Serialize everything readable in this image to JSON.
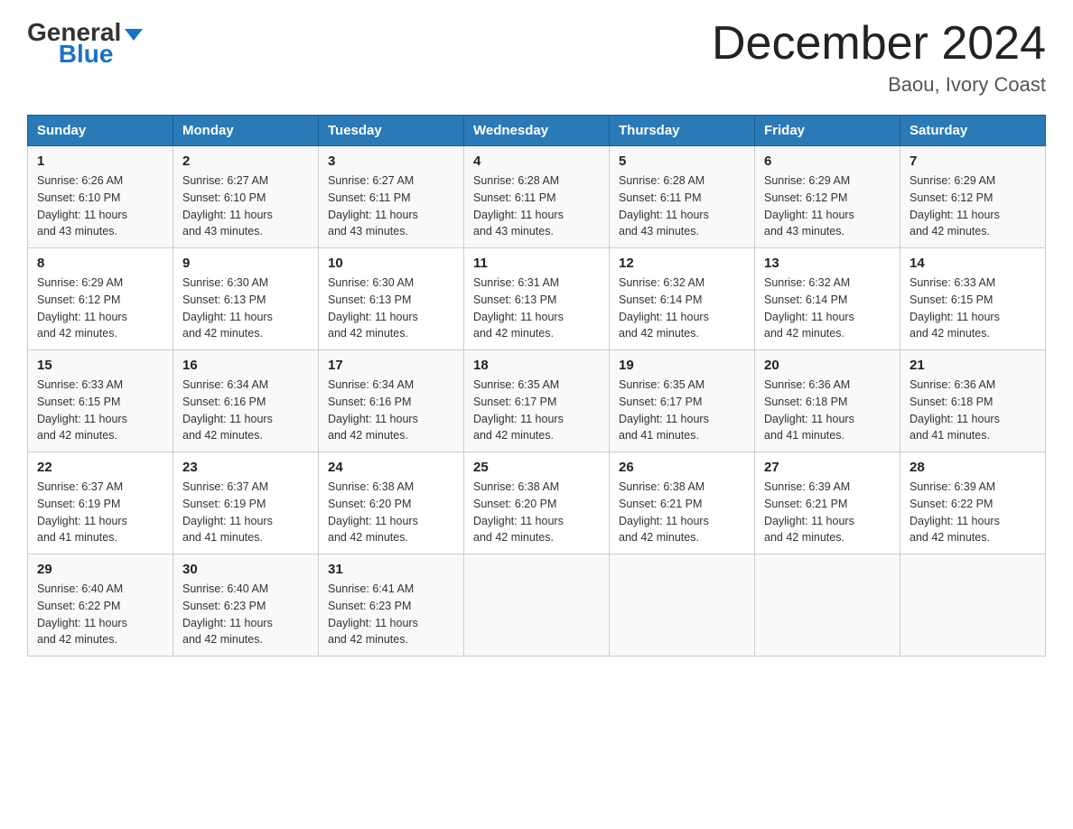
{
  "header": {
    "logo_general": "General",
    "logo_blue": "Blue",
    "month_title": "December 2024",
    "subtitle": "Baou, Ivory Coast"
  },
  "days_of_week": [
    "Sunday",
    "Monday",
    "Tuesday",
    "Wednesday",
    "Thursday",
    "Friday",
    "Saturday"
  ],
  "weeks": [
    [
      {
        "day": "1",
        "sunrise": "6:26 AM",
        "sunset": "6:10 PM",
        "daylight": "11 hours and 43 minutes."
      },
      {
        "day": "2",
        "sunrise": "6:27 AM",
        "sunset": "6:10 PM",
        "daylight": "11 hours and 43 minutes."
      },
      {
        "day": "3",
        "sunrise": "6:27 AM",
        "sunset": "6:11 PM",
        "daylight": "11 hours and 43 minutes."
      },
      {
        "day": "4",
        "sunrise": "6:28 AM",
        "sunset": "6:11 PM",
        "daylight": "11 hours and 43 minutes."
      },
      {
        "day": "5",
        "sunrise": "6:28 AM",
        "sunset": "6:11 PM",
        "daylight": "11 hours and 43 minutes."
      },
      {
        "day": "6",
        "sunrise": "6:29 AM",
        "sunset": "6:12 PM",
        "daylight": "11 hours and 43 minutes."
      },
      {
        "day": "7",
        "sunrise": "6:29 AM",
        "sunset": "6:12 PM",
        "daylight": "11 hours and 42 minutes."
      }
    ],
    [
      {
        "day": "8",
        "sunrise": "6:29 AM",
        "sunset": "6:12 PM",
        "daylight": "11 hours and 42 minutes."
      },
      {
        "day": "9",
        "sunrise": "6:30 AM",
        "sunset": "6:13 PM",
        "daylight": "11 hours and 42 minutes."
      },
      {
        "day": "10",
        "sunrise": "6:30 AM",
        "sunset": "6:13 PM",
        "daylight": "11 hours and 42 minutes."
      },
      {
        "day": "11",
        "sunrise": "6:31 AM",
        "sunset": "6:13 PM",
        "daylight": "11 hours and 42 minutes."
      },
      {
        "day": "12",
        "sunrise": "6:32 AM",
        "sunset": "6:14 PM",
        "daylight": "11 hours and 42 minutes."
      },
      {
        "day": "13",
        "sunrise": "6:32 AM",
        "sunset": "6:14 PM",
        "daylight": "11 hours and 42 minutes."
      },
      {
        "day": "14",
        "sunrise": "6:33 AM",
        "sunset": "6:15 PM",
        "daylight": "11 hours and 42 minutes."
      }
    ],
    [
      {
        "day": "15",
        "sunrise": "6:33 AM",
        "sunset": "6:15 PM",
        "daylight": "11 hours and 42 minutes."
      },
      {
        "day": "16",
        "sunrise": "6:34 AM",
        "sunset": "6:16 PM",
        "daylight": "11 hours and 42 minutes."
      },
      {
        "day": "17",
        "sunrise": "6:34 AM",
        "sunset": "6:16 PM",
        "daylight": "11 hours and 42 minutes."
      },
      {
        "day": "18",
        "sunrise": "6:35 AM",
        "sunset": "6:17 PM",
        "daylight": "11 hours and 42 minutes."
      },
      {
        "day": "19",
        "sunrise": "6:35 AM",
        "sunset": "6:17 PM",
        "daylight": "11 hours and 41 minutes."
      },
      {
        "day": "20",
        "sunrise": "6:36 AM",
        "sunset": "6:18 PM",
        "daylight": "11 hours and 41 minutes."
      },
      {
        "day": "21",
        "sunrise": "6:36 AM",
        "sunset": "6:18 PM",
        "daylight": "11 hours and 41 minutes."
      }
    ],
    [
      {
        "day": "22",
        "sunrise": "6:37 AM",
        "sunset": "6:19 PM",
        "daylight": "11 hours and 41 minutes."
      },
      {
        "day": "23",
        "sunrise": "6:37 AM",
        "sunset": "6:19 PM",
        "daylight": "11 hours and 41 minutes."
      },
      {
        "day": "24",
        "sunrise": "6:38 AM",
        "sunset": "6:20 PM",
        "daylight": "11 hours and 42 minutes."
      },
      {
        "day": "25",
        "sunrise": "6:38 AM",
        "sunset": "6:20 PM",
        "daylight": "11 hours and 42 minutes."
      },
      {
        "day": "26",
        "sunrise": "6:38 AM",
        "sunset": "6:21 PM",
        "daylight": "11 hours and 42 minutes."
      },
      {
        "day": "27",
        "sunrise": "6:39 AM",
        "sunset": "6:21 PM",
        "daylight": "11 hours and 42 minutes."
      },
      {
        "day": "28",
        "sunrise": "6:39 AM",
        "sunset": "6:22 PM",
        "daylight": "11 hours and 42 minutes."
      }
    ],
    [
      {
        "day": "29",
        "sunrise": "6:40 AM",
        "sunset": "6:22 PM",
        "daylight": "11 hours and 42 minutes."
      },
      {
        "day": "30",
        "sunrise": "6:40 AM",
        "sunset": "6:23 PM",
        "daylight": "11 hours and 42 minutes."
      },
      {
        "day": "31",
        "sunrise": "6:41 AM",
        "sunset": "6:23 PM",
        "daylight": "11 hours and 42 minutes."
      },
      null,
      null,
      null,
      null
    ]
  ],
  "labels": {
    "sunrise": "Sunrise:",
    "sunset": "Sunset:",
    "daylight": "Daylight:"
  }
}
